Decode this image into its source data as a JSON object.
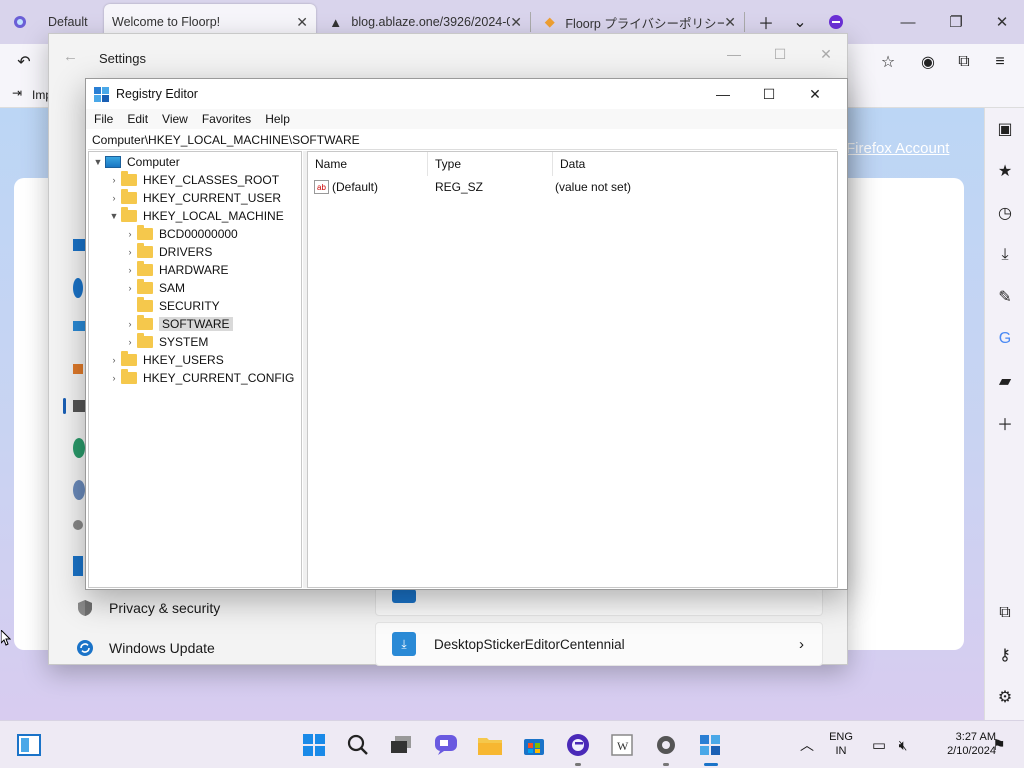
{
  "browser": {
    "tabs": [
      {
        "label": "Default",
        "icon": "floorp-icon"
      },
      {
        "label": "Welcome to Floorp!",
        "icon": "none",
        "active": true
      },
      {
        "label": "blog.ablaze.one/3926/2024-0",
        "icon": "warning-icon"
      },
      {
        "label": "Floorp プライバシーポリシー",
        "icon": "floorp-icon"
      }
    ],
    "bookmark_item": "Imp",
    "content_link": "Firefox Account"
  },
  "settings": {
    "title": "Settings",
    "nav_items": [
      {
        "label": "Privacy & security",
        "icon": "shield-icon"
      },
      {
        "label": "Windows Update",
        "icon": "refresh-icon"
      }
    ],
    "app_row": {
      "label": "DesktopStickerEditorCentennial",
      "icon": "sticker-app-icon"
    }
  },
  "regedit": {
    "title": "Registry Editor",
    "menu": [
      "File",
      "Edit",
      "View",
      "Favorites",
      "Help"
    ],
    "address": "Computer\\HKEY_LOCAL_MACHINE\\SOFTWARE",
    "tree": [
      {
        "label": "Computer",
        "expanded": true,
        "type": "computer"
      },
      {
        "label": "HKEY_CLASSES_ROOT",
        "expanded": false
      },
      {
        "label": "HKEY_CURRENT_USER",
        "expanded": false
      },
      {
        "label": "HKEY_LOCAL_MACHINE",
        "expanded": true
      },
      {
        "label": "BCD00000000",
        "expanded": false
      },
      {
        "label": "DRIVERS",
        "expanded": false
      },
      {
        "label": "HARDWARE",
        "expanded": false
      },
      {
        "label": "SAM",
        "expanded": false
      },
      {
        "label": "SECURITY",
        "expanded": false,
        "no_arrow": true
      },
      {
        "label": "SOFTWARE",
        "expanded": false,
        "selected": true
      },
      {
        "label": "SYSTEM",
        "expanded": false
      },
      {
        "label": "HKEY_USERS",
        "expanded": false
      },
      {
        "label": "HKEY_CURRENT_CONFIG",
        "expanded": false
      }
    ],
    "columns": [
      "Name",
      "Type",
      "Data"
    ],
    "values": [
      {
        "name": "(Default)",
        "type": "REG_SZ",
        "data": "(value not set)"
      }
    ]
  },
  "taskbar": {
    "lang_line1": "ENG",
    "lang_line2": "IN",
    "time": "3:27 AM",
    "date": "2/10/2024"
  }
}
